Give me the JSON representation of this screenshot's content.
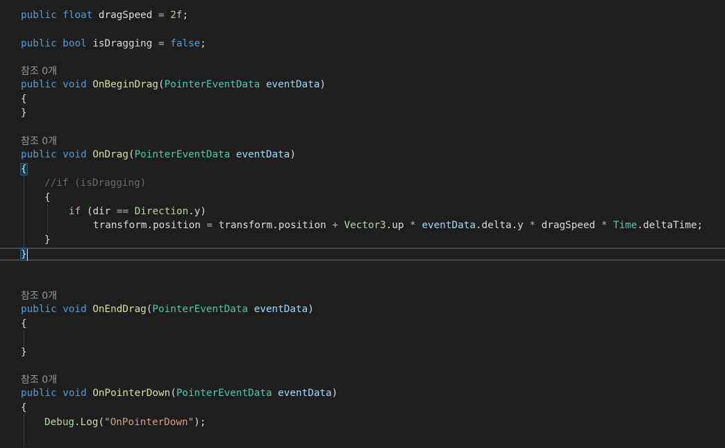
{
  "code": {
    "drag_speed_decl": {
      "modifier": "public",
      "type": "float",
      "name": "dragSpeed",
      "op": "=",
      "value": "2f",
      "end": ";"
    },
    "is_dragging_decl": {
      "modifier": "public",
      "type": "bool",
      "name": "isDragging",
      "op": "=",
      "value": "false",
      "end": ";"
    },
    "reference_lens": "참조 0개",
    "on_begin_drag": {
      "modifier": "public",
      "return_type": "void",
      "name": "OnBeginDrag",
      "param_type": "PointerEventData",
      "param_name": "eventData"
    },
    "on_drag": {
      "modifier": "public",
      "return_type": "void",
      "name": "OnDrag",
      "param_type": "PointerEventData",
      "param_name": "eventData",
      "comment": "//if (isDragging)",
      "if_keyword": "if",
      "cond_var": "dir",
      "cond_op": "==",
      "cond_enum": "Direction",
      "cond_member": "y",
      "assign_target": "transform.position",
      "assign_source": "transform.position",
      "vector_type": "Vector3",
      "vector_member": "up",
      "event_param": "eventData",
      "event_member": "delta.y",
      "speed_var": "dragSpeed",
      "time_type": "Time",
      "time_member": "deltaTime"
    },
    "on_end_drag": {
      "modifier": "public",
      "return_type": "void",
      "name": "OnEndDrag",
      "param_type": "PointerEventData",
      "param_name": "eventData"
    },
    "on_pointer_down": {
      "modifier": "public",
      "return_type": "void",
      "name": "OnPointerDown",
      "param_type": "PointerEventData",
      "param_name": "eventData",
      "debug_class": "Debug",
      "debug_method": "Log",
      "debug_string": "\"OnPointerDown\""
    }
  }
}
